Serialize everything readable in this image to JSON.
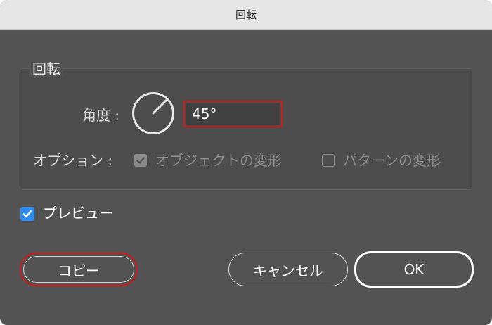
{
  "window": {
    "title": "回転"
  },
  "rotate_group": {
    "legend": "回転",
    "angle_label": "角度 :",
    "angle_value": "45°",
    "options_label": "オプション :",
    "options": [
      {
        "label": "オブジェクトの変形",
        "checked": true,
        "enabled": false
      },
      {
        "label": "パターンの変形",
        "checked": false,
        "enabled": false
      }
    ]
  },
  "preview": {
    "label": "プレビュー",
    "checked": true
  },
  "buttons": {
    "copy": "コピー",
    "cancel": "キャンセル",
    "ok": "OK"
  },
  "colors": {
    "dialog_bg": "#535353",
    "highlight_red": "#d01a1a",
    "checkbox_blue": "#2d8cf0"
  }
}
